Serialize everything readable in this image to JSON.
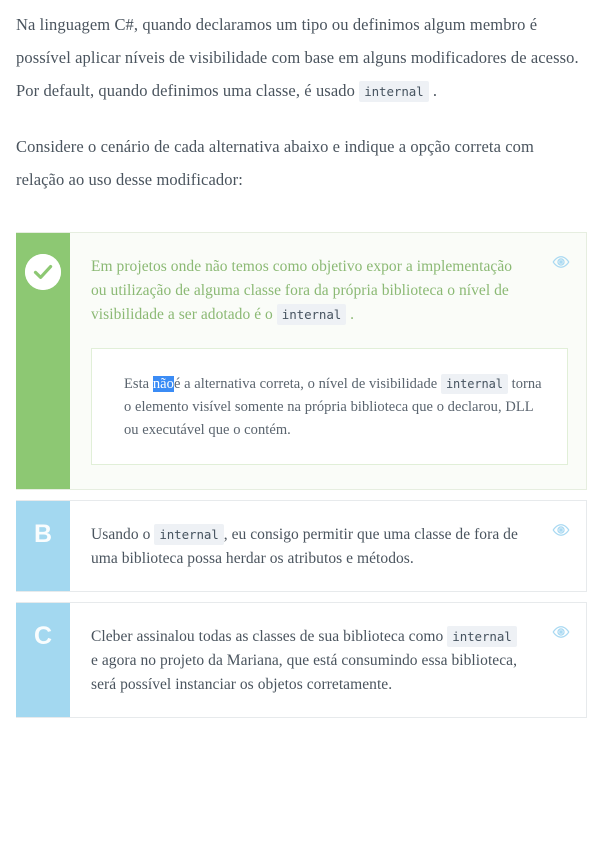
{
  "statement": {
    "paragraph_1_part_1": "Na linguagem C#, quando declaramos um tipo ou definimos algum membro é possível aplicar níveis de visibilidade com base em alguns modificadores de acesso. Por default, quando definimos uma classe, é usado",
    "paragraph_1_code": "internal",
    "paragraph_1_part_2": ".",
    "paragraph_2": "Considere o cenário de cada alternativa abaixo e indique a opção correta com relação ao uso desse modificador:"
  },
  "alternatives": [
    {
      "id": "a",
      "state": "correct",
      "marker_icon": "check-circle-icon",
      "marker_label": "",
      "text_part_1": "Em projetos onde não temos como objetivo expor a implementação ou utilização de alguma classe fora da própria biblioteca o nível de visibilidade a ser adotado é o",
      "code": "internal",
      "text_part_2": ".",
      "reveal_icon": "eye-icon",
      "feedback": {
        "lead": "Esta",
        "selected_word": "não",
        "part_1": "é a alternativa correta, o nível de visibilidade",
        "code": "internal",
        "part_2": "torna o elemento visível somente na própria biblioteca que o declarou, DLL ou executável que o contém."
      }
    },
    {
      "id": "b",
      "state": "neutral",
      "marker_icon": "",
      "marker_label": "B",
      "text_part_1": "Usando o",
      "code": "internal",
      "text_part_2": ", eu consigo permitir que uma classe de fora de uma biblioteca possa herdar os atributos e métodos.",
      "reveal_icon": "eye-icon"
    },
    {
      "id": "c",
      "state": "neutral",
      "marker_icon": "",
      "marker_label": "C",
      "text_part_1": "Cleber assinalou todas as classes de sua biblioteca como",
      "code": "internal",
      "text_part_2": "e agora no projeto da Mariana, que está consumindo essa biblioteca, será possível instanciar os objetos corretamente.",
      "reveal_icon": "eye-icon"
    }
  ],
  "colors": {
    "correct_bar": "#8dc873",
    "correct_text": "#8bb974",
    "neutral_bar": "#a3d8f0",
    "body_text": "#4a545e",
    "code_bg": "#eef1f5",
    "selection_blue": "#3b8cf5",
    "feedback_border": "#e1efd8"
  }
}
